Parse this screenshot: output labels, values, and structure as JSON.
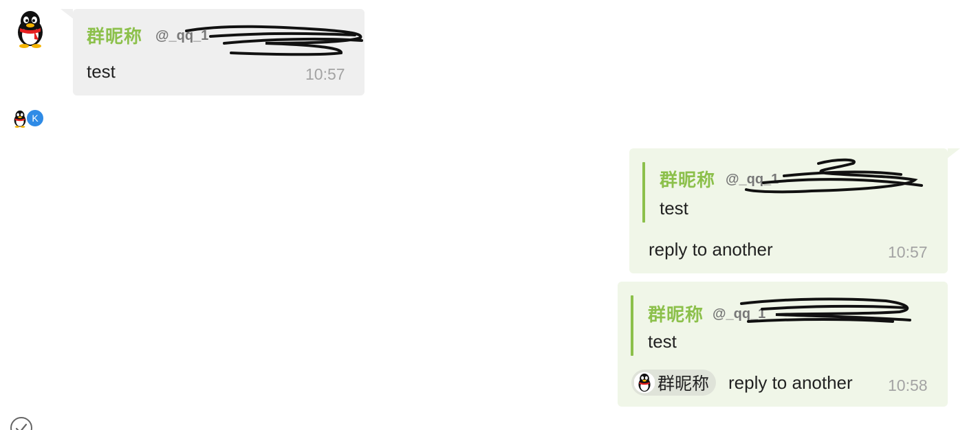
{
  "messages": [
    {
      "sender_name": "群昵称",
      "sender_handle": "@_qq_1",
      "text": "test",
      "time": "10:57"
    },
    {
      "quote": {
        "sender_name": "群昵称",
        "sender_handle": "@_qq_1",
        "text": "test"
      },
      "text": "reply to another",
      "time": "10:57"
    },
    {
      "quote": {
        "sender_name": "群昵称",
        "sender_handle": "@_qq_1",
        "text": "test"
      },
      "mention": "群昵称",
      "text": "reply to another",
      "time": "10:58"
    }
  ],
  "reactions": {
    "badge_letter": "K",
    "badge_color": "#2f8be6"
  },
  "colors": {
    "accent": "#8cc04b",
    "incoming_bubble": "#efefef",
    "outgoing_bubble": "#f0f6e8",
    "time_text": "#a3a3a3"
  },
  "icons": [
    "qq-penguin-avatar-icon",
    "check-circle-icon"
  ]
}
